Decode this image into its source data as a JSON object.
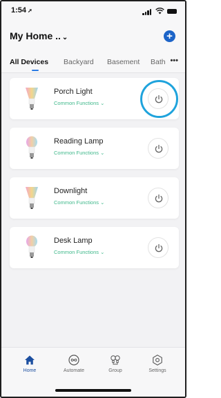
{
  "status_bar": {
    "time": "1:54",
    "location_arrow": "➚"
  },
  "header": {
    "title": "My Home ..",
    "title_chevron": "⌄",
    "add_icon": "+"
  },
  "tabs": {
    "items": [
      "All Devices",
      "Backyard",
      "Basement",
      "Bath"
    ],
    "more": "•••",
    "active_index": 0
  },
  "devices": [
    {
      "name": "Porch Light",
      "subtitle": "Common Functions ⌄",
      "highlighted": true
    },
    {
      "name": "Reading Lamp",
      "subtitle": "Common Functions ⌄",
      "highlighted": false
    },
    {
      "name": "Downlight",
      "subtitle": "Common Functions ⌄",
      "highlighted": false
    },
    {
      "name": "Desk Lamp",
      "subtitle": "Common Functions ⌄",
      "highlighted": false
    }
  ],
  "bottom_nav": {
    "items": [
      {
        "label": "Home",
        "icon": "home-icon",
        "active": true
      },
      {
        "label": "Automate",
        "icon": "automate-icon",
        "active": false
      },
      {
        "label": "Group",
        "icon": "group-icon",
        "active": false
      },
      {
        "label": "Settings",
        "icon": "settings-icon",
        "active": false
      }
    ]
  },
  "colors": {
    "accent_blue": "#1c64c8",
    "tab_indicator": "#2a7be4",
    "subtitle_green": "#3fb88b",
    "highlight_ring": "#1fa3dc"
  }
}
